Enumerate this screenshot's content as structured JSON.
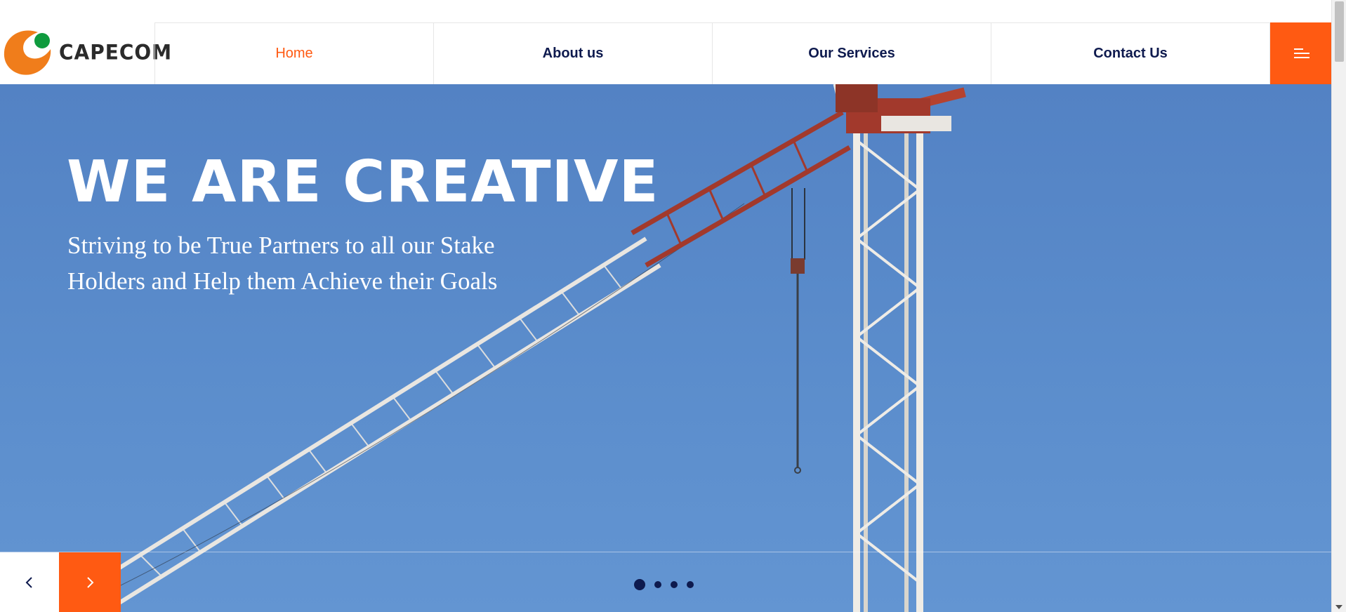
{
  "brand": {
    "name": "CAPECOM",
    "colors": {
      "orange": "#ff5a12",
      "green": "#0f9b3e",
      "navy": "#0e1a4e"
    }
  },
  "nav": {
    "items": [
      {
        "label": "Home",
        "active": true
      },
      {
        "label": "About us",
        "active": false
      },
      {
        "label": "Our Services",
        "active": false
      },
      {
        "label": "Contact Us",
        "active": false
      }
    ],
    "menu_icon": "hamburger-icon"
  },
  "hero": {
    "title": "WE ARE CREATIVE",
    "subtitle": "Striving to be True Partners to all our Stake Holders and Help them Achieve their Goals",
    "prev_icon": "chevron-left-icon",
    "next_icon": "chevron-right-icon",
    "slides_count": 4,
    "active_slide": 1
  }
}
